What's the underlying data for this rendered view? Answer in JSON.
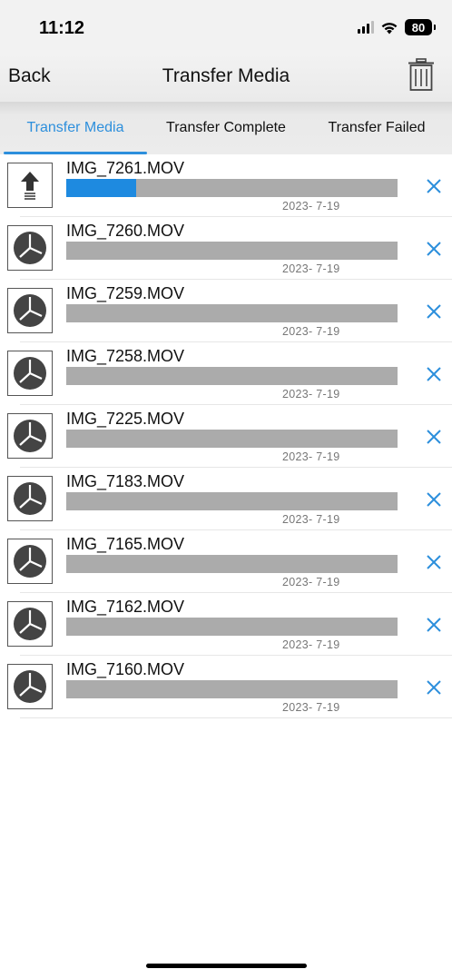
{
  "status_bar": {
    "time": "11:12",
    "battery": "80"
  },
  "nav": {
    "back_label": "Back",
    "title": "Transfer Media",
    "trash_icon": "trash-icon"
  },
  "tabs": [
    {
      "label": "Transfer Media",
      "active": true
    },
    {
      "label": "Transfer Complete",
      "active": false
    },
    {
      "label": "Transfer Failed",
      "active": false
    }
  ],
  "colors": {
    "accent": "#2d8fdc",
    "progress_fill": "#1e8ae0",
    "progress_track": "#ababab"
  },
  "transfers": [
    {
      "name": "IMG_7261.MOV",
      "date": "2023- 7-19",
      "status_icon": "upload-arrow-icon",
      "progress": 0.21
    },
    {
      "name": "IMG_7260.MOV",
      "date": "2023- 7-19",
      "status_icon": "clock-icon",
      "progress": 0
    },
    {
      "name": "IMG_7259.MOV",
      "date": "2023- 7-19",
      "status_icon": "clock-icon",
      "progress": 0
    },
    {
      "name": "IMG_7258.MOV",
      "date": "2023- 7-19",
      "status_icon": "clock-icon",
      "progress": 0
    },
    {
      "name": "IMG_7225.MOV",
      "date": "2023- 7-19",
      "status_icon": "clock-icon",
      "progress": 0
    },
    {
      "name": "IMG_7183.MOV",
      "date": "2023- 7-19",
      "status_icon": "clock-icon",
      "progress": 0
    },
    {
      "name": "IMG_7165.MOV",
      "date": "2023- 7-19",
      "status_icon": "clock-icon",
      "progress": 0
    },
    {
      "name": "IMG_7162.MOV",
      "date": "2023- 7-19",
      "status_icon": "clock-icon",
      "progress": 0
    },
    {
      "name": "IMG_7160.MOV",
      "date": "2023- 7-19",
      "status_icon": "clock-icon",
      "progress": 0
    }
  ]
}
